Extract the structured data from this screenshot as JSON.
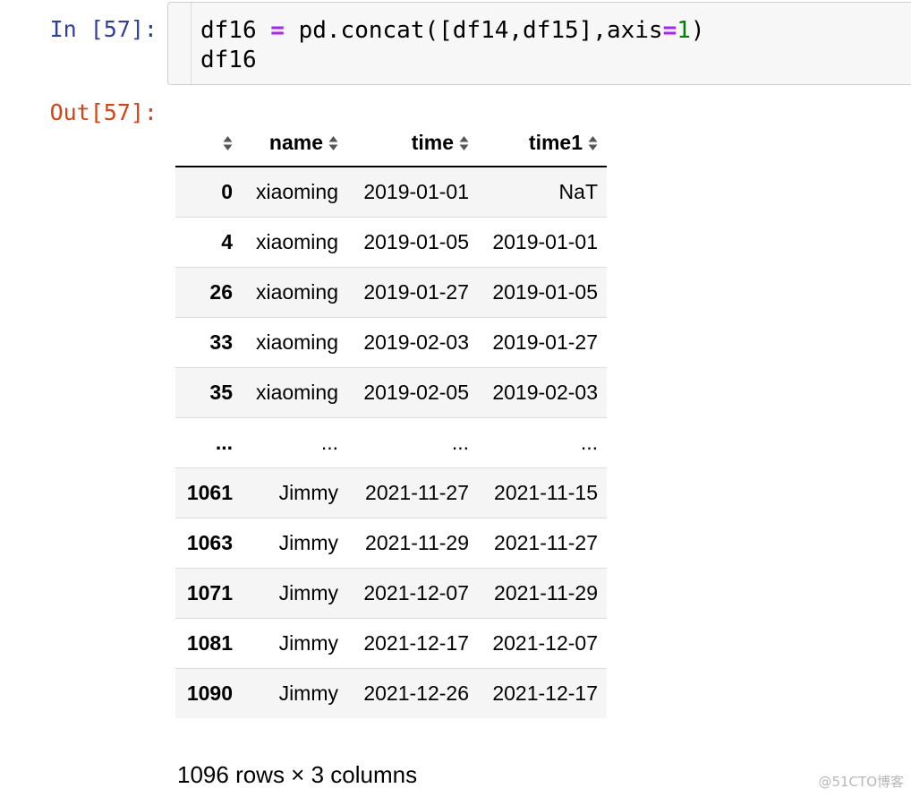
{
  "input_cell": {
    "prompt": "In [57]:",
    "code_lines": [
      [
        {
          "t": "df16 ",
          "c": ""
        },
        {
          "t": "=",
          "c": "op"
        },
        {
          "t": " pd.concat([df14,df15],axis",
          "c": ""
        },
        {
          "t": "=",
          "c": "op"
        },
        {
          "t": "1",
          "c": "num"
        },
        {
          "t": ")",
          "c": ""
        }
      ],
      [
        {
          "t": "df16",
          "c": ""
        }
      ]
    ]
  },
  "output_cell": {
    "prompt": "Out[57]:",
    "table": {
      "columns": [
        "",
        "name",
        "time",
        "time1"
      ],
      "rows": [
        {
          "index": "0",
          "name": "xiaoming",
          "time": "2019-01-01",
          "time1": "NaT"
        },
        {
          "index": "4",
          "name": "xiaoming",
          "time": "2019-01-05",
          "time1": "2019-01-01"
        },
        {
          "index": "26",
          "name": "xiaoming",
          "time": "2019-01-27",
          "time1": "2019-01-05"
        },
        {
          "index": "33",
          "name": "xiaoming",
          "time": "2019-02-03",
          "time1": "2019-01-27"
        },
        {
          "index": "35",
          "name": "xiaoming",
          "time": "2019-02-05",
          "time1": "2019-02-03"
        },
        {
          "index": "...",
          "name": "...",
          "time": "...",
          "time1": "..."
        },
        {
          "index": "1061",
          "name": "Jimmy",
          "time": "2021-11-27",
          "time1": "2021-11-15"
        },
        {
          "index": "1063",
          "name": "Jimmy",
          "time": "2021-11-29",
          "time1": "2021-11-27"
        },
        {
          "index": "1071",
          "name": "Jimmy",
          "time": "2021-12-07",
          "time1": "2021-11-29"
        },
        {
          "index": "1081",
          "name": "Jimmy",
          "time": "2021-12-17",
          "time1": "2021-12-07"
        },
        {
          "index": "1090",
          "name": "Jimmy",
          "time": "2021-12-26",
          "time1": "2021-12-17"
        }
      ],
      "sort_icon": "sort-updown-icon"
    },
    "shape_info": "1096 rows × 3 columns"
  },
  "watermark": "@51CTO博客",
  "colors": {
    "in_prompt": "#303f9f",
    "out_prompt": "#d84315",
    "operator": "#aa22ff",
    "number": "#008000"
  }
}
